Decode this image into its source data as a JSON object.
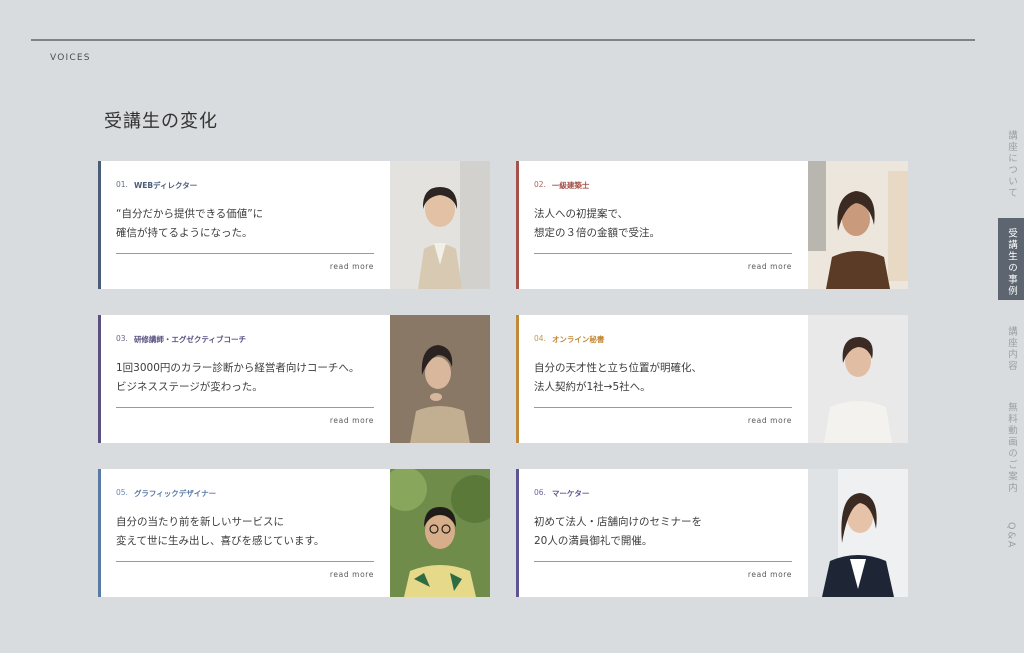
{
  "section_label": "VOICES",
  "title": "受講生の変化",
  "nav": [
    {
      "label": "講座について",
      "active": false
    },
    {
      "label": "受講生の事例",
      "active": true
    },
    {
      "label": "講座内容",
      "active": false
    },
    {
      "label": "無料動画のご案内",
      "active": false
    },
    {
      "label": "Q&A",
      "active": false
    }
  ],
  "cards": [
    {
      "num": "01.",
      "role": "WEBディレクター",
      "line1": "“自分だから提供できる価値”に",
      "line2": "確信が持てるようになった。",
      "more": "read more",
      "accent": "#4a5d77"
    },
    {
      "num": "02.",
      "role": "一級建築士",
      "line1": "法人への初提案で、",
      "line2": "想定の３倍の金額で受注。",
      "more": "read more",
      "accent": "#a5524a"
    },
    {
      "num": "03.",
      "role": "研修講師・エグゼクティブコーチ",
      "line1": "1回3000円のカラー診断から経営者向けコーチへ。",
      "line2": "ビジネスステージが変わった。",
      "more": "read more",
      "accent": "#5a5180"
    },
    {
      "num": "04.",
      "role": "オンライン秘書",
      "line1": "自分の天才性と立ち位置が明確化、",
      "line2": "法人契約が1社→5社へ。",
      "more": "read more",
      "accent": "#c08a3a"
    },
    {
      "num": "05.",
      "role": "グラフィックデザイナー",
      "line1": "自分の当たり前を新しいサービスに",
      "line2": "変えて世に生み出し、喜びを感じています。",
      "more": "read more",
      "accent": "#5a7aa6"
    },
    {
      "num": "06.",
      "role": "マーケター",
      "line1": "初めて法人・店舗向けのセミナーを",
      "line2": "20人の満員御礼で開催。",
      "more": "read more",
      "accent": "#5e5493"
    }
  ]
}
